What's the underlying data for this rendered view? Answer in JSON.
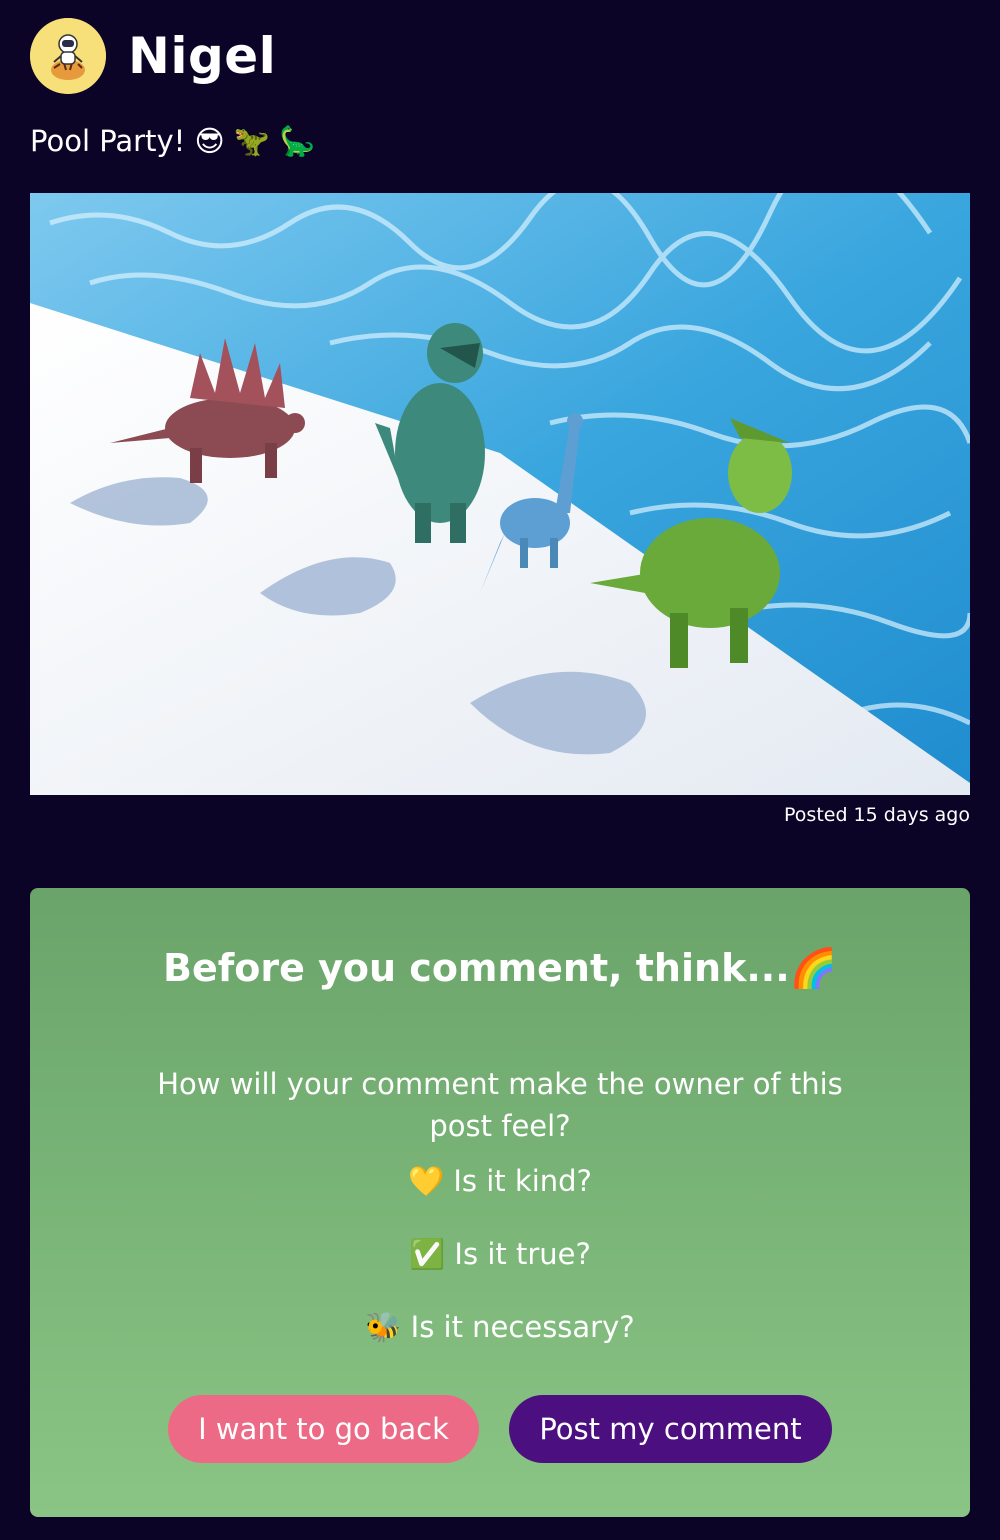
{
  "post": {
    "username": "Nigel",
    "caption": "Pool Party! 😎 🦖 🦕",
    "photo_alt": "",
    "posted": "Posted 15 days ago"
  },
  "prompt": {
    "title": "Before you comment, think...🌈",
    "question": "How will your comment make the owner of this post feel?",
    "checks": [
      "💛 Is it kind?",
      "✅ Is it true?",
      "🐝 Is it necessary?"
    ],
    "back_label": "I want to go back",
    "post_label": "Post my comment"
  },
  "colors": {
    "background": "#0b0427",
    "card_top": "#6aa46a",
    "card_bottom": "#8ac585",
    "back_button": "#ec6a86",
    "post_button": "#4b0f80",
    "avatar_bg": "#f7df7a"
  },
  "icons": {
    "avatar": "astronaut-tiger-avatar-icon"
  }
}
